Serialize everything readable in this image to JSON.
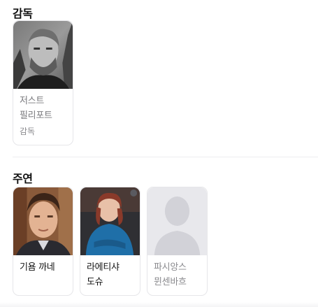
{
  "director_section": {
    "title": "감독",
    "people": [
      {
        "name": "저스트 필리포트",
        "role": "감독",
        "photo_icon": "director-photo"
      }
    ]
  },
  "cast_section": {
    "title": "주연",
    "people": [
      {
        "name": "기욤 까네",
        "photo_icon": "actor-photo"
      },
      {
        "name": "라에티샤 도슈",
        "photo_icon": "actress-photo"
      },
      {
        "name": "파시앙스 뮌센바흐",
        "photo_icon": "person-placeholder-icon"
      }
    ]
  },
  "colors": {
    "card_border": "#e6e6e9",
    "muted_text": "#8a8a8e",
    "placeholder_bg": "#e8e8ec",
    "placeholder_silhouette": "#d2d2d8"
  }
}
